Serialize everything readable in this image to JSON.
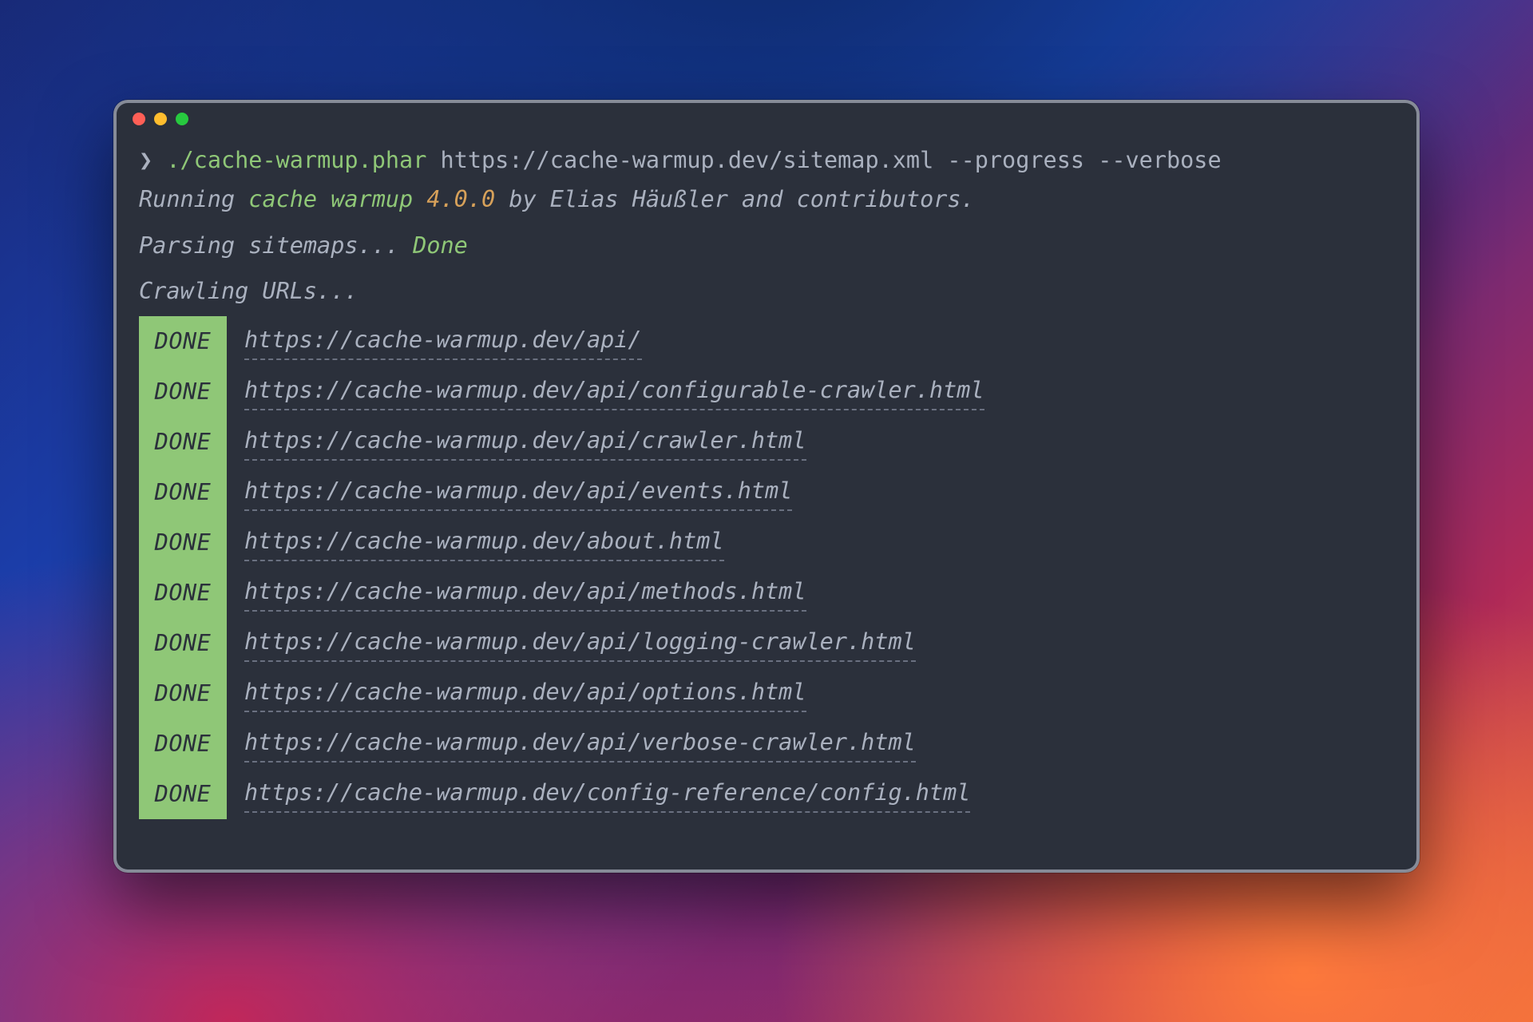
{
  "titlebar": {
    "close": "close",
    "minimize": "minimize",
    "zoom": "zoom"
  },
  "prompt": {
    "symbol": "❯",
    "executable": "./cache-warmup.phar",
    "arg_url": "https://cache-warmup.dev/sitemap.xml",
    "flag_progress": "--progress",
    "flag_verbose": "--verbose"
  },
  "banner": {
    "prefix": "Running ",
    "app_name": "cache warmup",
    "version": "4.0.0",
    "suffix": " by Elias Häußler and contributors."
  },
  "parsing": {
    "label": "Parsing sitemaps... ",
    "status": "Done"
  },
  "crawling": {
    "label": "Crawling URLs..."
  },
  "badge_label": "DONE",
  "urls": [
    "https://cache-warmup.dev/api/",
    "https://cache-warmup.dev/api/configurable-crawler.html",
    "https://cache-warmup.dev/api/crawler.html",
    "https://cache-warmup.dev/api/events.html",
    "https://cache-warmup.dev/about.html",
    "https://cache-warmup.dev/api/methods.html",
    "https://cache-warmup.dev/api/logging-crawler.html",
    "https://cache-warmup.dev/api/options.html",
    "https://cache-warmup.dev/api/verbose-crawler.html",
    "https://cache-warmup.dev/config-reference/config.html"
  ]
}
